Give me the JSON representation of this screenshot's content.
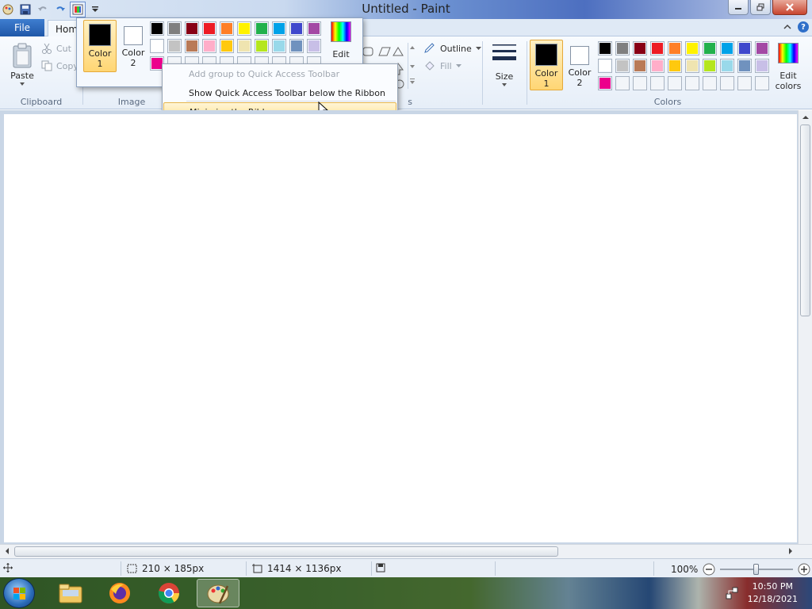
{
  "window": {
    "title": "Untitled - Paint"
  },
  "tabs": {
    "file": "File",
    "home": "Home"
  },
  "clipboard": {
    "paste": "Paste",
    "cut": "Cut",
    "copy": "Copy",
    "group": "Clipboard"
  },
  "image": {
    "group": "Image"
  },
  "shapes": {
    "outline": "Outline",
    "fill": "Fill",
    "group_tail": "s"
  },
  "size": {
    "label": "Size"
  },
  "colors": {
    "color1_line1": "Color",
    "color1_line2": "1",
    "color2_line1": "Color",
    "color2_line2": "2",
    "edit_line1": "Edit",
    "edit_line2": "colors",
    "group": "Colors",
    "color1": "#000000",
    "color2": "#ffffff",
    "palette_row1": [
      "#000000",
      "#7f7f7f",
      "#880015",
      "#ed1c24",
      "#ff7f27",
      "#fff200",
      "#22b14c",
      "#00a2e8",
      "#3f48cc",
      "#a349a4"
    ],
    "palette_row2": [
      "#ffffff",
      "#c3c3c3",
      "#b97a57",
      "#ffaec9",
      "#ffc90e",
      "#efe4b0",
      "#b5e61d",
      "#99d9ea",
      "#7092be",
      "#c8bfe7"
    ],
    "palette_row3": [
      "#ec008c"
    ]
  },
  "gallery": {
    "edit": "Edit"
  },
  "context_menu": {
    "add_group": "Add group to Quick Access Toolbar",
    "show_below": "Show Quick Access Toolbar below the Ribbon",
    "minimize": "Minimize the Ribbon"
  },
  "status": {
    "selection": "210 × 185px",
    "image_size": "1414 × 1136px",
    "zoom": "100%"
  },
  "clock": {
    "time": "10:50 PM",
    "date": "12/18/2021"
  }
}
